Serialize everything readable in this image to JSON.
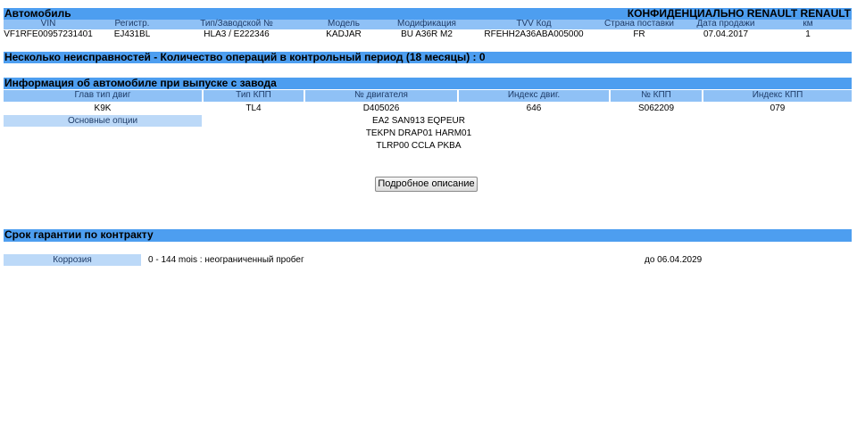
{
  "vehicle": {
    "title": "Автомобиль",
    "confidential": "КОНФИДЕНЦИАЛЬНО RENAULT RENAULT",
    "headers": [
      "VIN",
      "Регистр.",
      "Тип/Заводской №",
      "Модель",
      "Модификация",
      "TVV Код",
      "Страна поставки",
      "Дата продажи",
      "км"
    ],
    "values": [
      "VF1RFE00957231401",
      "EJ431BL",
      "HLA3 / E222346",
      "KADJAR",
      "BU A36R M2",
      "RFEHH2A36ABA005000",
      "FR",
      "07.04.2017",
      "1"
    ]
  },
  "faults": {
    "title": "Несколько неисправностей - Количество операций в контрольный период (18 месяцы) : 0"
  },
  "factory": {
    "title": "Информация об автомобиле при выпуске с завода",
    "headers": [
      "Глав тип двиг",
      "Тип КПП",
      "№ двигателя",
      "Индекс двиг.",
      "№ КПП",
      "Индекс КПП"
    ],
    "values": [
      "K9K",
      "TL4",
      "D405026",
      "646",
      "S062209",
      "079"
    ],
    "options_label": "Основные опции",
    "options": [
      "EA2 SAN913 EQPEUR",
      "TEKPN DRAP01 HARM01",
      "TLRP00 CCLA PKBA"
    ],
    "details_button": "Подробное описание"
  },
  "warranty": {
    "title": "Срок гарантии по контракту",
    "row_label": "Коррозия",
    "row_value": "0 - 144 mois : неограниченный пробег",
    "row_until": "до  06.04.2029"
  },
  "colors": {
    "header_bar": "#4d9ef0",
    "subheader": "#8fc1f6",
    "label_box": "#bcd9f8"
  }
}
